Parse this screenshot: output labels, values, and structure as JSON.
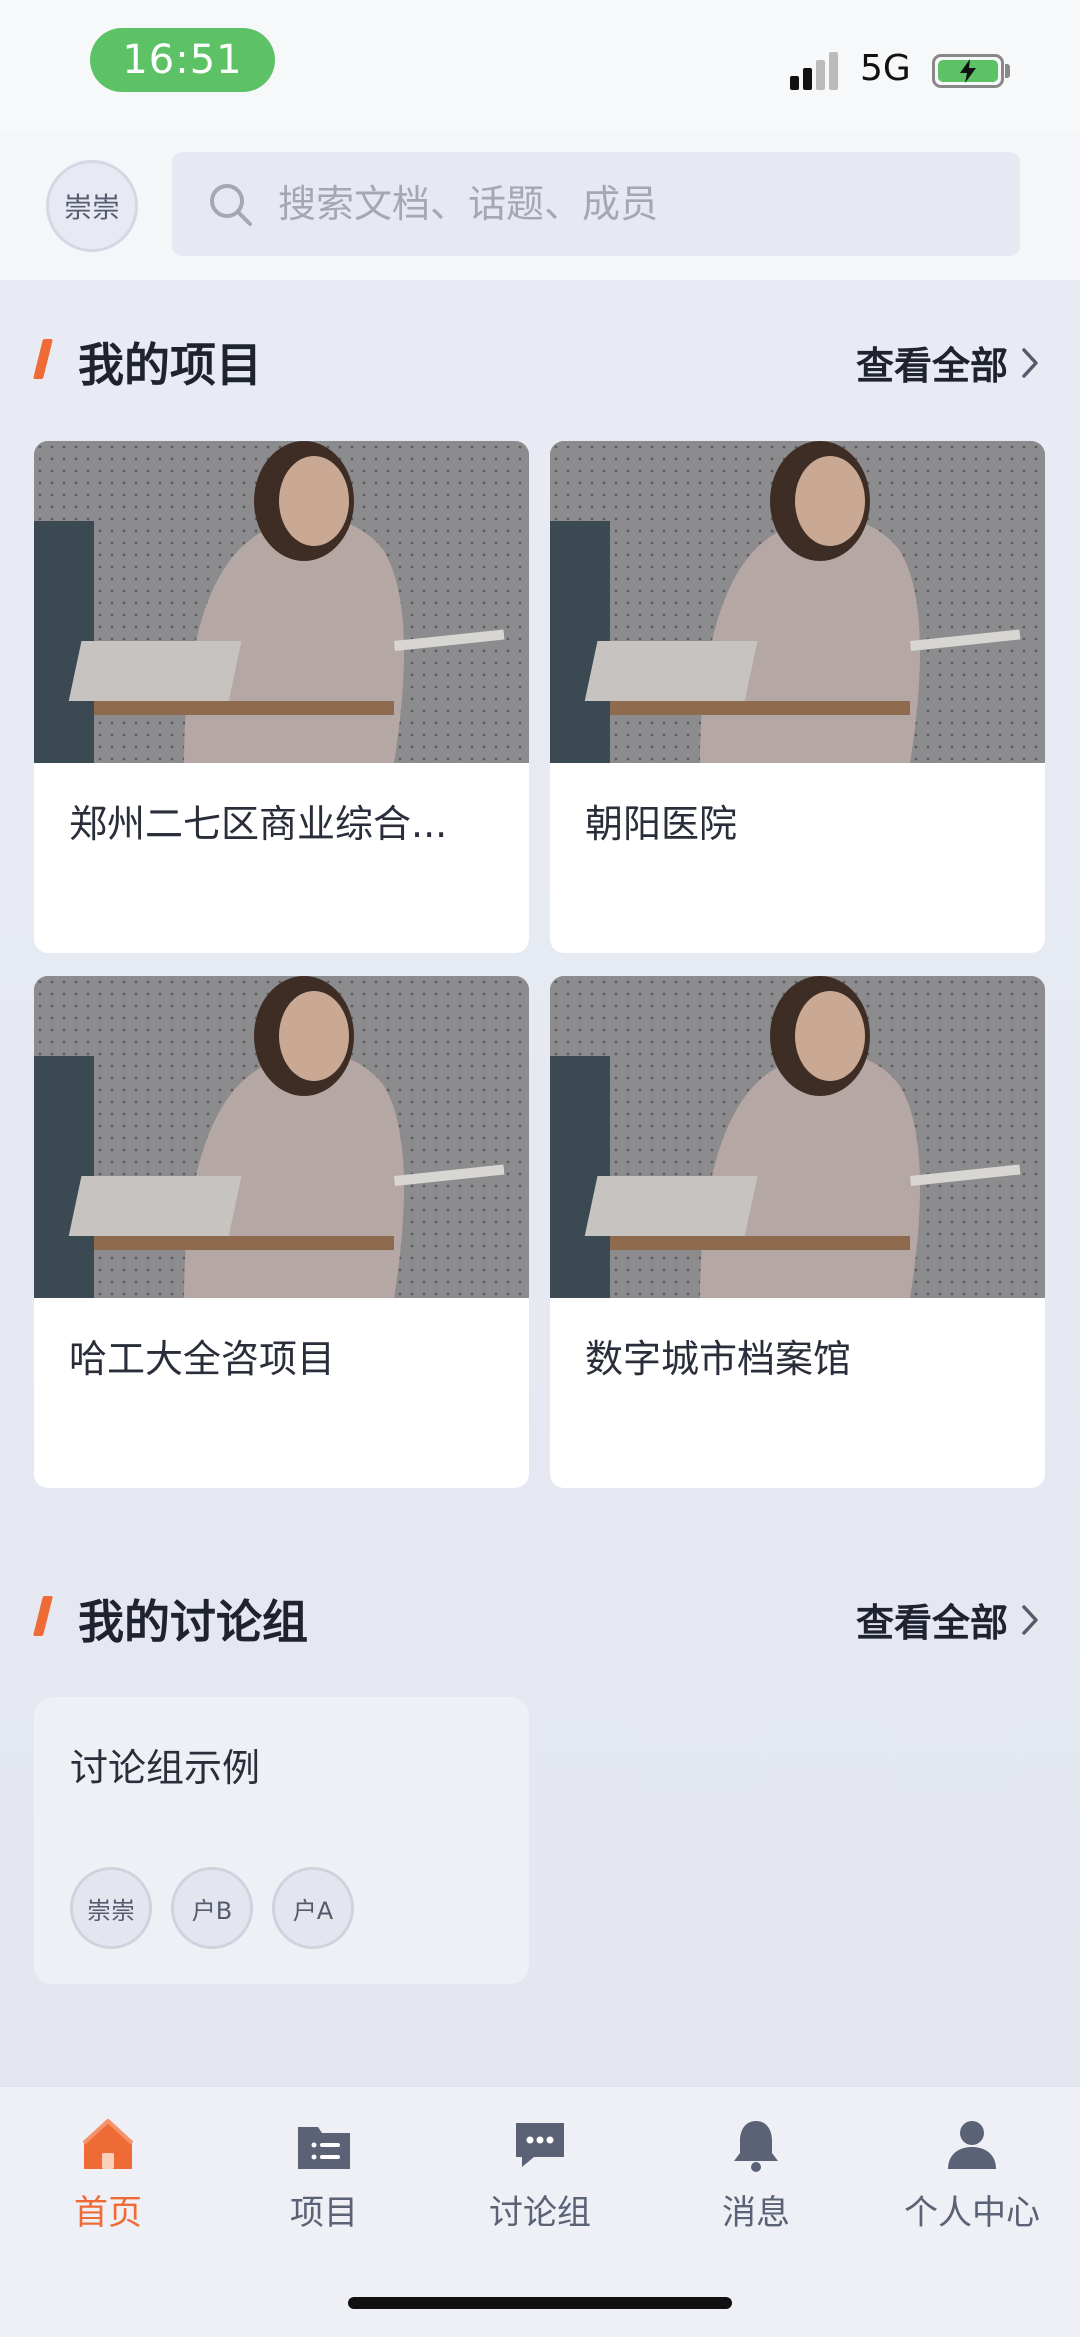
{
  "status_bar": {
    "time": "16:51",
    "network": "5G"
  },
  "header": {
    "avatar_text": "崇崇",
    "search_placeholder": "搜索文档、话题、成员"
  },
  "projects_section": {
    "title": "我的项目",
    "more_label": "查看全部",
    "items": [
      {
        "name": "郑州二七区商业综合..."
      },
      {
        "name": "朝阳医院"
      },
      {
        "name": "哈工大全咨项目"
      },
      {
        "name": "数字城市档案馆"
      }
    ]
  },
  "discussion_section": {
    "title": "我的讨论组",
    "more_label": "查看全部",
    "items": [
      {
        "name": "讨论组示例",
        "members": [
          "崇崇",
          "户B",
          "户A"
        ]
      }
    ]
  },
  "tabbar": {
    "items": [
      {
        "label": "首页",
        "icon": "home-icon",
        "active": true
      },
      {
        "label": "项目",
        "icon": "folder-list-icon",
        "active": false
      },
      {
        "label": "讨论组",
        "icon": "chat-bubble-icon",
        "active": false
      },
      {
        "label": "消息",
        "icon": "bell-icon",
        "active": false
      },
      {
        "label": "个人中心",
        "icon": "person-icon",
        "active": false
      }
    ]
  },
  "colors": {
    "accent": "#ef6b35",
    "status_green": "#5cc265",
    "tab_inactive": "#5b6275"
  }
}
